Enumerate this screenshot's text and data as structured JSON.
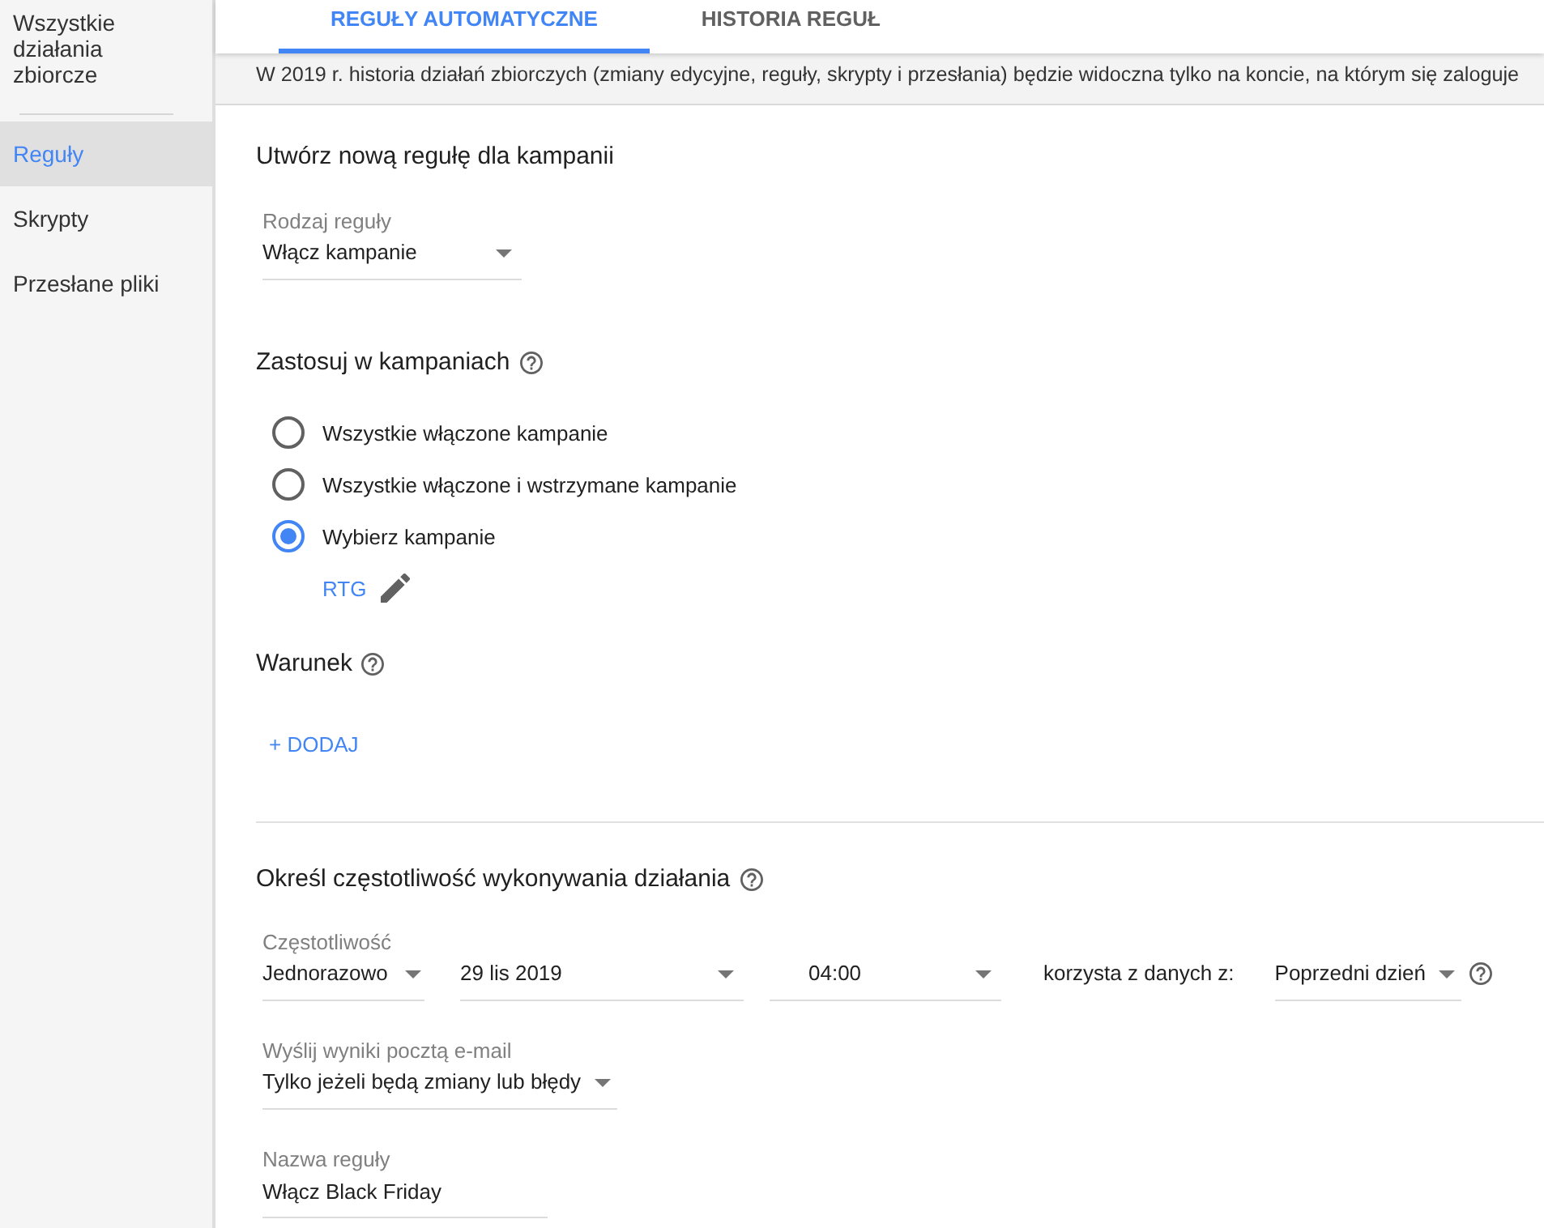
{
  "sidebar": {
    "sections": [
      {
        "items": [
          {
            "label": "Wszystkie działania zbiorcze",
            "selected": false
          }
        ]
      },
      {
        "items": [
          {
            "label": "Reguły",
            "selected": true
          },
          {
            "label": "Skrypty",
            "selected": false
          },
          {
            "label": "Przesłane pliki",
            "selected": false
          }
        ]
      }
    ]
  },
  "tabs": [
    {
      "label": "REGUŁY AUTOMATYCZNE",
      "selected": true
    },
    {
      "label": "HISTORIA REGUŁ",
      "selected": false
    }
  ],
  "notice": "W 2019 r. historia działań zbiorczych (zmiany edycyjne, reguły, skrypty i przesłania) będzie widoczna tylko na koncie, na którym się zaloguje",
  "form": {
    "title": "Utwórz nową regułę dla kampanii",
    "rule_type": {
      "label": "Rodzaj reguły",
      "value": "Włącz kampanie"
    },
    "apply_to": {
      "title": "Zastosuj w kampaniach",
      "options": [
        {
          "label": "Wszystkie włączone kampanie",
          "selected": false
        },
        {
          "label": "Wszystkie włączone i wstrzymane kampanie",
          "selected": false
        },
        {
          "label": "Wybierz kampanie",
          "selected": true
        }
      ],
      "campaign_link": "RTG"
    },
    "condition": {
      "title": "Warunek",
      "add_button": "+ DODAJ"
    },
    "schedule": {
      "title": "Określ częstotliwość wykonywania działania",
      "frequency": {
        "label": "Częstotliwość",
        "value": "Jednorazowo"
      },
      "date": {
        "value": "29 lis 2019"
      },
      "time": {
        "value": "04:00"
      },
      "data_source": {
        "label": "korzysta z danych z:",
        "value": "Poprzedni dzień"
      }
    },
    "email": {
      "label": "Wyślij wyniki pocztą e-mail",
      "value": "Tylko jeżeli będą zmiany lub błędy"
    },
    "rule_name": {
      "label": "Nazwa reguły",
      "value": "Włącz Black Friday"
    }
  }
}
